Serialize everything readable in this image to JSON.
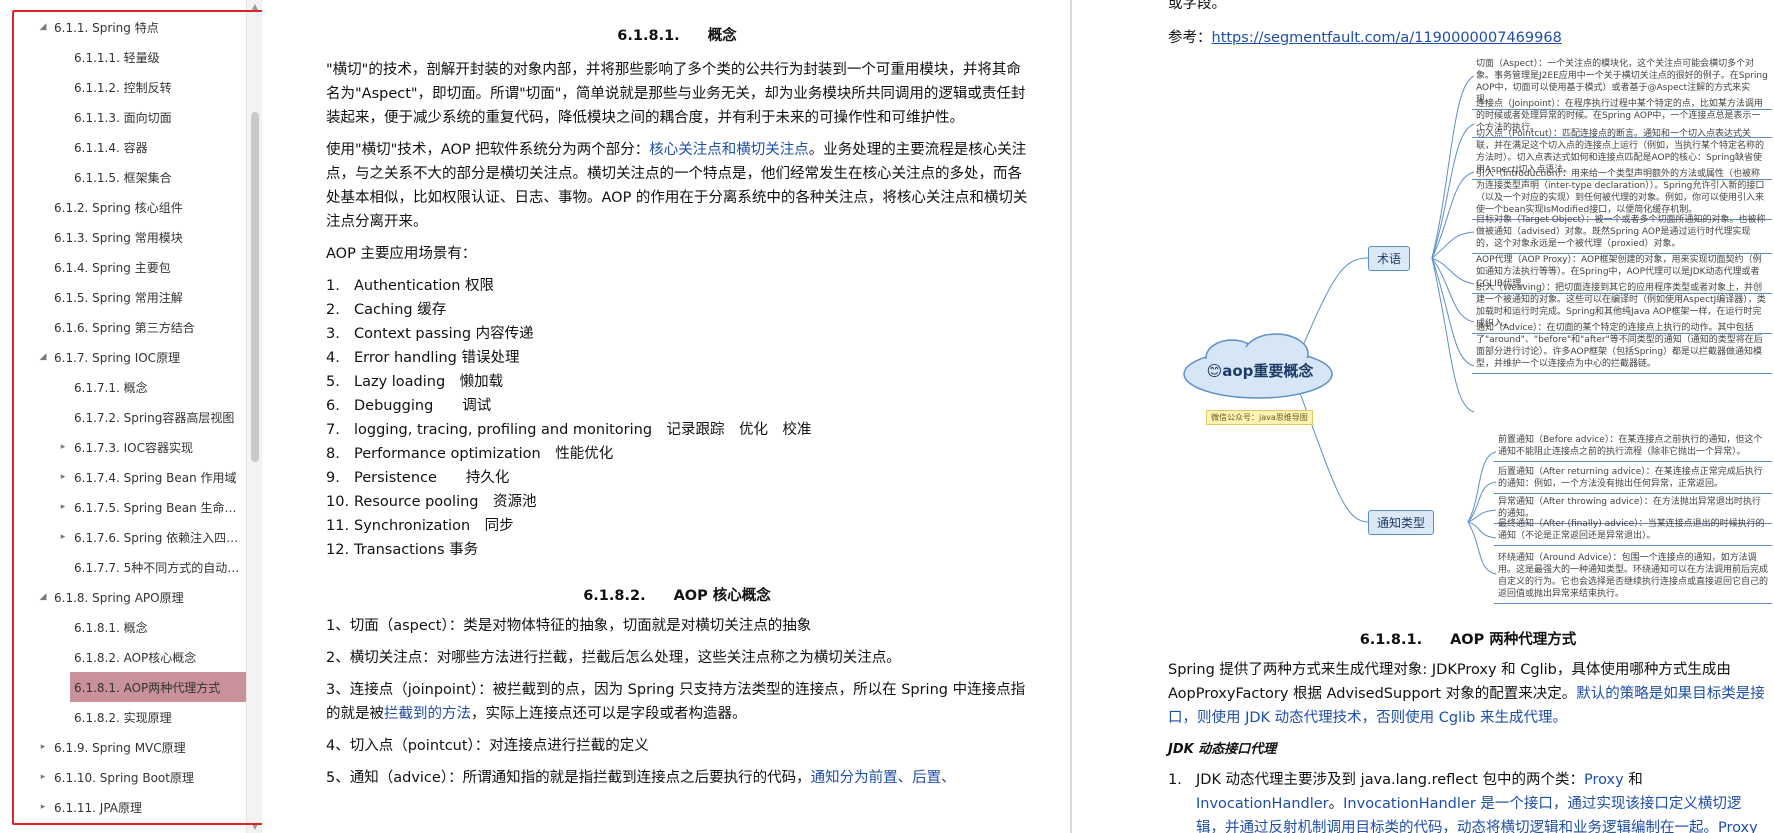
{
  "outline": {
    "items": [
      {
        "label": "6.1.1. Spring 特点",
        "level": 2,
        "marker": "open"
      },
      {
        "label": "6.1.1.1. 轻量级",
        "level": 3,
        "marker": "none"
      },
      {
        "label": "6.1.1.2. 控制反转",
        "level": 3,
        "marker": "none"
      },
      {
        "label": "6.1.1.3. 面向切面",
        "level": 3,
        "marker": "none"
      },
      {
        "label": "6.1.1.4. 容器",
        "level": 3,
        "marker": "none"
      },
      {
        "label": "6.1.1.5. 框架集合",
        "level": 3,
        "marker": "none"
      },
      {
        "label": "6.1.2. Spring 核心组件",
        "level": 2,
        "marker": "none"
      },
      {
        "label": "6.1.3. Spring 常用模块",
        "level": 2,
        "marker": "none"
      },
      {
        "label": "6.1.4. Spring 主要包",
        "level": 2,
        "marker": "none"
      },
      {
        "label": "6.1.5. Spring 常用注解",
        "level": 2,
        "marker": "none"
      },
      {
        "label": "6.1.6. Spring 第三方结合",
        "level": 2,
        "marker": "none"
      },
      {
        "label": "6.1.7. Spring IOC原理",
        "level": 2,
        "marker": "open"
      },
      {
        "label": "6.1.7.1. 概念",
        "level": 3,
        "marker": "none"
      },
      {
        "label": "6.1.7.2. Spring容器高层视图",
        "level": 3,
        "marker": "none"
      },
      {
        "label": "6.1.7.3. IOC容器实现",
        "level": 3,
        "marker": "closed"
      },
      {
        "label": "6.1.7.4. Spring Bean 作用域",
        "level": 3,
        "marker": "closed"
      },
      {
        "label": "6.1.7.5. Spring Bean 生命周期",
        "level": 3,
        "marker": "closed"
      },
      {
        "label": "6.1.7.6. Spring 依赖注入四种...",
        "level": 3,
        "marker": "closed"
      },
      {
        "label": "6.1.7.7. 5种不同方式的自动装...",
        "level": 3,
        "marker": "none"
      },
      {
        "label": "6.1.8. Spring APO原理",
        "level": 2,
        "marker": "open"
      },
      {
        "label": "6.1.8.1. 概念",
        "level": 3,
        "marker": "none"
      },
      {
        "label": "6.1.8.2. AOP核心概念",
        "level": 3,
        "marker": "none"
      },
      {
        "label": "6.1.8.1. AOP两种代理方式",
        "level": 3,
        "marker": "closed",
        "active": true
      },
      {
        "label": "6.1.8.2. 实现原理",
        "level": 3,
        "marker": "none"
      },
      {
        "label": "6.1.9. Spring MVC原理",
        "level": 2,
        "marker": "closed"
      },
      {
        "label": "6.1.10. Spring Boot原理",
        "level": 2,
        "marker": "closed"
      },
      {
        "label": "6.1.11. JPA原理",
        "level": 2,
        "marker": "closed"
      }
    ]
  },
  "left": {
    "sec1": {
      "num": "6.1.8.1.",
      "title": "概念"
    },
    "p1": "\"横切\"的技术，剖解开封装的对象内部，并将那些影响了多个类的公共行为封装到一个可重用模块，并将其命名为\"Aspect\"，即切面。所谓\"切面\"，简单说就是那些与业务无关，却为业务模块所共同调用的逻辑或责任封装起来，便于减少系统的重复代码，降低模块之间的耦合度，并有利于未来的可操作性和可维护性。",
    "p2a": "使用\"横切\"技术，AOP 把软件系统分为两个部分：",
    "p2b": "核心关注点和横切关注点",
    "p2c": "。业务处理的主要流程是核心关注点，与之关系不大的部分是横切关注点。横切关注点的一个特点是，他们经常发生在核心关注点的多处，而各处基本相似，比如权限认证、日志、事物。AOP 的作用在于分离系统中的各种关注点，将核心关注点和横切关注点分离开来。",
    "p3": "AOP 主要应用场景有：",
    "list": [
      {
        "n": "1.",
        "t": "Authentication 权限"
      },
      {
        "n": "2.",
        "t": "Caching 缓存"
      },
      {
        "n": "3.",
        "t": "Context passing 内容传递"
      },
      {
        "n": "4.",
        "t": "Error handling 错误处理"
      },
      {
        "n": "5.",
        "t": "Lazy loading　懒加载"
      },
      {
        "n": "6.",
        "t": "Debugging　　调试"
      },
      {
        "n": "7.",
        "t": "logging, tracing, profiling and monitoring　记录跟踪　优化　校准"
      },
      {
        "n": "8.",
        "t": "Performance optimization　性能优化"
      },
      {
        "n": "9.",
        "t": "Persistence　　持久化"
      },
      {
        "n": "10.",
        "t": "Resource pooling　资源池"
      },
      {
        "n": "11.",
        "t": "Synchronization　同步"
      },
      {
        "n": "12.",
        "t": "Transactions 事务"
      }
    ],
    "sec2": {
      "num": "6.1.8.2.",
      "title": "AOP 核心概念"
    },
    "c1": "1、切面（aspect）：类是对物体特征的抽象，切面就是对横切关注点的抽象",
    "c2": "2、横切关注点：对哪些方法进行拦截，拦截后怎么处理，这些关注点称之为横切关注点。",
    "c3a": "3、连接点（joinpoint）：被拦截到的点，因为 Spring 只支持方法类型的连接点，所以在 Spring 中连接点指的就是被",
    "c3b": "拦截到的方法",
    "c3c": "，实际上连接点还可以是字段或者构造器。",
    "c4": "4、切入点（pointcut）：对连接点进行拦截的定义",
    "c5a": "5、通知（advice）：所谓通知指的就是指拦截到连接点之后要执行的代码，",
    "c5b": "通知分为前置、后置、"
  },
  "right": {
    "top": "或字段。",
    "ref_label": "参考：",
    "ref_url": "https://segmentfault.com/a/1190000007469968",
    "mindmap": {
      "center": "😊aop重要概念",
      "watermark": "微信公众号：java思维导图",
      "tag1": "术语",
      "tag2": "通知类型",
      "terms": [
        "切面（Aspect）：一个关注点的模块化，这个关注点可能会横切多个对象。事务管理是J2EE应用中一个关于横切关注点的很好的例子。在Spring AOP中，切面可以使用基于模式）或者基于@Aspect注解的方式来实现。",
        "连接点（Joinpoint）：在程序执行过程中某个特定的点，比如某方法调用的时候或者处理异常的时候。在Spring AOP中，一个连接点总是表示一个方法的执行。",
        "切入点（Pointcut）：匹配连接点的断言。通知和一个切入点表达式关联，并在满足这个切入点的连接点上运行（例如，当执行某个特定名称的方法时）。切入点表达式如何和连接点匹配是AOP的核心：Spring缺省使用AspectJ切入点语法。",
        "引入（Introduction）：用来给一个类型声明额外的方法或属性（也被称为连接类型声明（inter-type declaration））。Spring允许引入新的接口（以及一个对应的实现）到任何被代理的对象。例如，你可以使用引入来使一个bean实现IsModified接口，以便简化缓存机制。",
        "目标对象（Target Object）：被一个或者多个切面所通知的对象。也被称做被通知（advised）对象。既然Spring AOP是通过运行时代理实现的，这个对象永远是一个被代理（proxied）对象。",
        "AOP代理（AOP Proxy）：AOP框架创建的对象，用来实现切面契约（例如通知方法执行等等）。在Spring中，AOP代理可以是JDK动态代理或者CGLIB代理。",
        "织入（Weaving）：把切面连接到其它的应用程序类型或者对象上，并创建一个被通知的对象。这些可以在编译时（例如使用AspectJ编译器），类加载时和运行时完成。Spring和其他纯Java AOP框架一样，在运行时完成织入。",
        "通知（Advice）：在切面的某个特定的连接点上执行的动作。其中包括了\"around\"、\"before\"和\"after\"等不同类型的通知（通知的类型将在后面部分进行讨论）。许多AOP框架（包括Spring）都是以拦截器做通知模型，并维护一个以连接点为中心的拦截器链。"
      ],
      "advices": [
        "前置通知（Before advice）：在某连接点之前执行的通知，但这个通知不能阻止连接点之前的执行流程（除非它抛出一个异常）。",
        "后置通知（After returning advice）：在某连接点正常完成后执行的通知：例如，一个方法没有抛出任何异常，正常返回。",
        "异常通知（After throwing advice）：在方法抛出异常退出时执行的通知。",
        "最终通知（After (finally) advice）：当某连接点退出的时候执行的通知（不论是正常返回还是异常退出）。",
        "环绕通知（Around Advice）：包围一个连接点的通知，如方法调用。这是最强大的一种通知类型。环绕通知可以在方法调用前后完成自定义的行为。它也会选择是否继续执行连接点或直接返回它自己的返回值或抛出异常来结束执行。"
      ]
    },
    "sec": {
      "num": "6.1.8.1.",
      "title": "AOP 两种代理方式"
    },
    "p1a": "Spring 提供了两种方式来生成代理对象: JDKProxy 和 Cglib，具体使用哪种方式生成由 AopProxyFactory 根据 AdvisedSupport 对象的配置来决定。",
    "p1b": "默认的策略是如果目标类是接口，则使用 JDK 动态代理技术，否则使用 Cglib 来生成代理。",
    "sub": "JDK 动态接口代理",
    "item1_n": "1.",
    "item1a": "JDK 动态代理主要涉及到 java.lang.reflect 包中的两个类：",
    "item1b": "Proxy",
    "item1c": " 和 ",
    "item1d": "InvocationHandler",
    "item1e": "。",
    "item1f": "InvocationHandler 是一个接口，通过实现该接口定义横切逻辑，并通过反射机制调用目标类的代码，动态将横切逻辑和业务逻辑编制在一起。Proxy 利用 InvocationHandler 动态创建"
  }
}
